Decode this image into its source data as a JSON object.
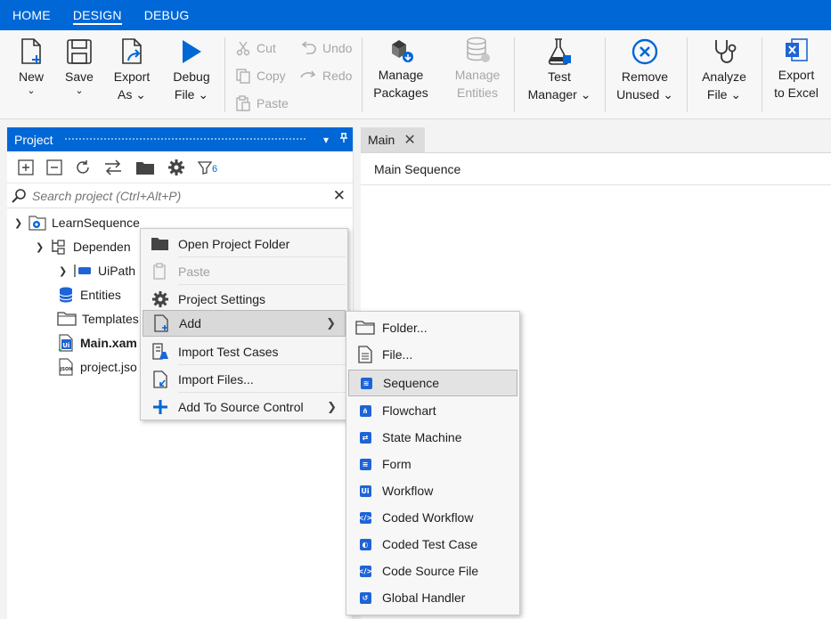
{
  "topbar": {
    "tabs": [
      "HOME",
      "DESIGN",
      "DEBUG"
    ],
    "active": "DESIGN"
  },
  "ribbon": {
    "new": {
      "label": "New",
      "chev": "⌄"
    },
    "save": {
      "label": "Save",
      "chev": "⌄"
    },
    "export_as": {
      "line1": "Export",
      "line2": "As ⌄"
    },
    "debug_file": {
      "line1": "Debug",
      "line2": "File ⌄"
    },
    "cut": "Cut",
    "copy": "Copy",
    "paste": "Paste",
    "undo": "Undo",
    "redo": "Redo",
    "manage_packages": {
      "line1": "Manage",
      "line2": "Packages"
    },
    "manage_entities": {
      "line1": "Manage",
      "line2": "Entities"
    },
    "test_manager": {
      "line1": "Test",
      "line2": "Manager ⌄"
    },
    "remove_unused": {
      "line1": "Remove",
      "line2": "Unused ⌄"
    },
    "analyze_file": {
      "line1": "Analyze",
      "line2": "File ⌄"
    },
    "export_excel": {
      "line1": "Export",
      "line2": "to Excel"
    }
  },
  "project_panel": {
    "title": "Project",
    "filter_count": "6",
    "search_placeholder": "Search project (Ctrl+Alt+P)",
    "tree": {
      "root": "LearnSequence",
      "dependencies": "Dependen",
      "uipath": "UiPath",
      "entities": "Entities",
      "templates": "Templates",
      "main": "Main.xam",
      "project_json": "project.jso"
    }
  },
  "document": {
    "tab": "Main",
    "breadcrumb": "Main Sequence"
  },
  "context_menu": {
    "items": [
      {
        "label": "Open Project Folder"
      },
      {
        "label": "Paste"
      },
      {
        "label": "Project Settings"
      },
      {
        "label": "Add"
      },
      {
        "label": "Import Test Cases"
      },
      {
        "label": "Import Files..."
      },
      {
        "label": "Add To Source Control"
      }
    ]
  },
  "add_submenu": {
    "items": [
      {
        "label": "Folder..."
      },
      {
        "label": "File..."
      },
      {
        "label": "Sequence"
      },
      {
        "label": "Flowchart"
      },
      {
        "label": "State Machine"
      },
      {
        "label": "Form"
      },
      {
        "label": "Workflow"
      },
      {
        "label": "Coded Workflow"
      },
      {
        "label": "Coded Test Case"
      },
      {
        "label": "Code Source File"
      },
      {
        "label": "Global Handler"
      }
    ],
    "highlighted": "Sequence"
  },
  "colors": {
    "accent": "#0067d6",
    "icon_blue": "#1e64d6",
    "disabled": "#a6a6a6"
  }
}
